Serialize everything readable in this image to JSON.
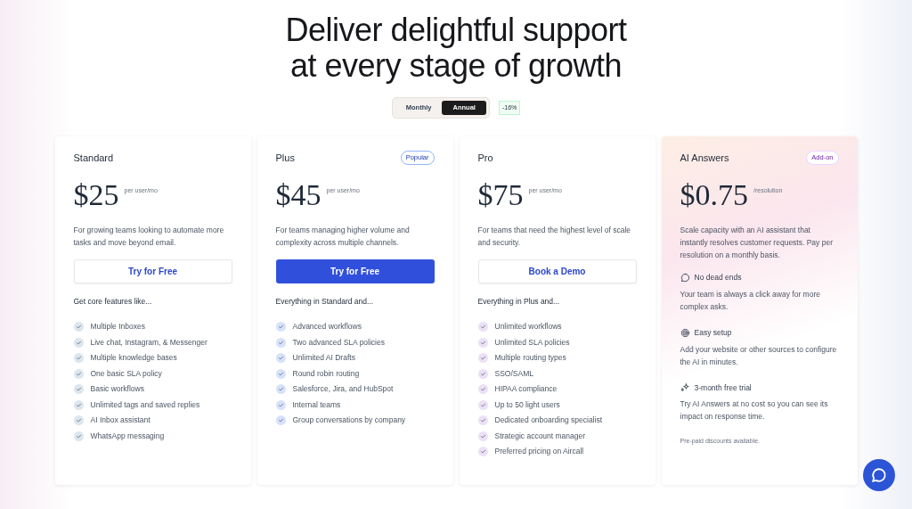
{
  "heading": [
    "Deliver delightful support",
    "at every stage of growth"
  ],
  "billing_toggle": {
    "options": [
      {
        "label": "Monthly",
        "selected": false
      },
      {
        "label": "Annual",
        "selected": true
      }
    ],
    "discount": "-16%"
  },
  "plans": [
    {
      "kind": "plan",
      "name": "Standard",
      "price": "$25",
      "unit": "per user/mo",
      "description": "For growing teams looking to automate more tasks and move beyond email.",
      "cta": {
        "label": "Try for Free",
        "kind": "outline"
      },
      "features_heading": "Get core features like...",
      "color": "#dbe6ef",
      "features": [
        "Multiple Inboxes",
        "Live chat, Instagram, & Messenger",
        "Multiple knowledge bases",
        "One basic SLA policy",
        "Basic workflows",
        "Unlimited tags and saved replies",
        "AI Inbox assistant",
        "WhatsApp messaging"
      ]
    },
    {
      "kind": "plan",
      "name": "Plus",
      "badge": "Popular",
      "price": "$45",
      "unit": "per user/mo",
      "description": "For teams managing higher volume and complexity across multiple channels.",
      "cta": {
        "label": "Try for Free",
        "kind": "filled"
      },
      "features_heading": "Everything in Standard and...",
      "color": "#d6e2fb",
      "features": [
        "Advanced workflows",
        "Two advanced SLA policies",
        "Unlimited AI Drafts",
        "Round robin routing",
        "Salesforce, Jira, and HubSpot",
        "Internal teams",
        "Group conversations by company"
      ]
    },
    {
      "kind": "plan",
      "name": "Pro",
      "price": "$75",
      "unit": "per user/mo",
      "description": "For teams that need the highest level of scale and security.",
      "cta": {
        "label": "Book a Demo",
        "kind": "outline"
      },
      "features_heading": "Everything in Plus and...",
      "color": "#ece0f7",
      "features": [
        "Unlimited workflows",
        "Unlimited SLA policies",
        "Multiple routing types",
        "SSO/SAML",
        "HIPAA compliance",
        "Up to 50 light users",
        "Dedicated onboarding specialist",
        "Strategic account manager",
        "Preferred pricing on Aircall"
      ]
    },
    {
      "kind": "addon",
      "name": "AI Answers",
      "badge": "Add-on",
      "price": "$0.75",
      "unit": "/resolution",
      "description": "Scale capacity with an AI assistant that instantly resolves customer requests. Pay per resolution on a monthly basis.",
      "highlights": [
        {
          "kind": "chat",
          "title": "No dead ends",
          "text": "Your team is always a click away for more complex asks."
        },
        {
          "kind": "target",
          "title": "Easy setup",
          "text": "Add your website or other sources to configure the AI in minutes."
        },
        {
          "kind": "sparkle",
          "title": "3-month free trial",
          "text": "Try AI Answers at no cost so you can see its impact on response time."
        }
      ],
      "note": "Pre-paid discounts available."
    }
  ]
}
